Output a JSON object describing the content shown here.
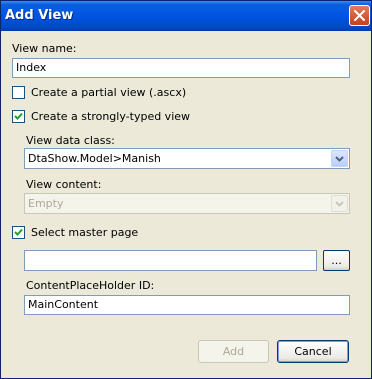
{
  "dialog": {
    "title": "Add View"
  },
  "view_name": {
    "label": "View name:",
    "value": "Index"
  },
  "partial_view": {
    "label": "Create a partial view (.ascx)",
    "checked": false
  },
  "strongly_typed": {
    "label": "Create a strongly-typed view",
    "checked": true
  },
  "view_data_class": {
    "label": "View data class:",
    "value": "DtaShow.Model>Manish"
  },
  "view_content": {
    "label": "View content:",
    "value": "Empty"
  },
  "master_page": {
    "label": "Select master page",
    "checked": true,
    "path_value": "",
    "browse_label": "..."
  },
  "content_placeholder": {
    "label": "ContentPlaceHolder ID:",
    "value": "MainContent"
  },
  "buttons": {
    "add": "Add",
    "cancel": "Cancel"
  }
}
